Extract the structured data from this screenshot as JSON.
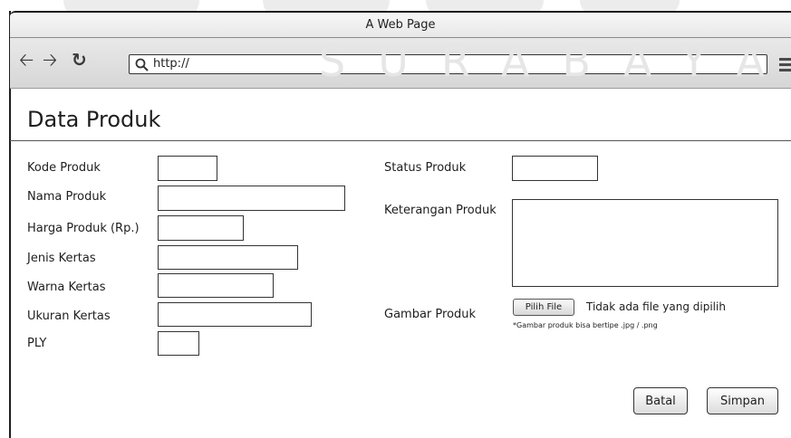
{
  "watermark": {
    "text": "SURABAYA"
  },
  "browser": {
    "window_title": "A Web Page",
    "url": "http://",
    "icons": [
      "back-arrow-icon",
      "forward-arrow-icon",
      "refresh-icon",
      "search-icon",
      "menu-icon"
    ]
  },
  "page": {
    "title": "Data Produk"
  },
  "form_left": [
    {
      "label": "Kode Produk"
    },
    {
      "label": "Nama Produk"
    },
    {
      "label": "Harga Produk (Rp.)"
    },
    {
      "label": "Jenis Kertas"
    },
    {
      "label": "Warna Kertas"
    },
    {
      "label": "Ukuran Kertas"
    },
    {
      "label": "PLY"
    }
  ],
  "form_right": {
    "status_label": "Status Produk",
    "keterangan_label": "Keterangan Produk",
    "gambar_label": "Gambar Produk",
    "file_button": "Pilih File",
    "file_status": "Tidak ada file yang dipilih",
    "file_note": "*Gambar produk bisa bertipe .jpg / .png"
  },
  "actions": {
    "cancel": "Batal",
    "save": "Simpan"
  }
}
